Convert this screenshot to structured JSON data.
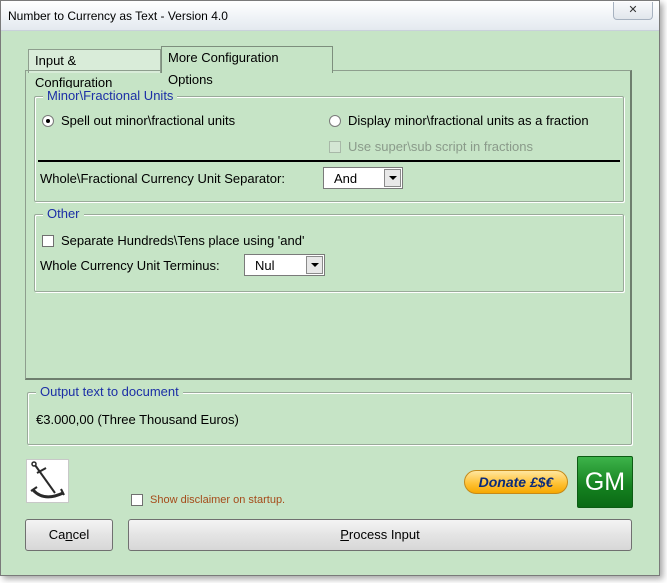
{
  "window": {
    "title": "Number to Currency as Text - Version 4.0",
    "close_glyph": "✕"
  },
  "tabs": [
    {
      "label": "Input & Configuration",
      "active": false
    },
    {
      "label": "More Configuration Options",
      "active": true
    }
  ],
  "minor_units": {
    "legend": "Minor\\Fractional Units",
    "option_spell_out": "Spell out minor\\fractional units",
    "option_spell_out_selected": true,
    "option_fraction": "Display minor\\fractional  units as a fraction",
    "option_fraction_selected": false,
    "superscript_label": "Use super\\sub script in fractions",
    "superscript_checked": false,
    "superscript_disabled": true,
    "separator_label": "Whole\\Fractional Currency Unit Separator:",
    "separator_value": "And"
  },
  "other": {
    "legend": "Other",
    "hundreds_tens_label": "Separate Hundreds\\Tens place using 'and'",
    "hundreds_tens_checked": false,
    "terminus_label": "Whole Currency Unit Terminus:",
    "terminus_value": "Nul"
  },
  "output": {
    "legend": "Output text to document",
    "value": "€3.000,00 (Three Thousand Euros)"
  },
  "footer": {
    "disclaimer_label": "Show disclaimer on startup.",
    "disclaimer_checked": false,
    "donate_label": "Donate £$€",
    "gm_label": "GM",
    "cancel_label_pre": "Ca",
    "cancel_label_accel": "n",
    "cancel_label_post": "cel",
    "process_label_accel": "P",
    "process_label_post": "rocess Input"
  },
  "colors": {
    "window_bg": "#c6e4c6",
    "legend_text": "#1c2fa6",
    "disclaimer_text": "#a54b1a",
    "donate_gold": "#ffc338",
    "gm_green": "#14801f"
  },
  "icons": {
    "logo": "anchor-icon"
  }
}
